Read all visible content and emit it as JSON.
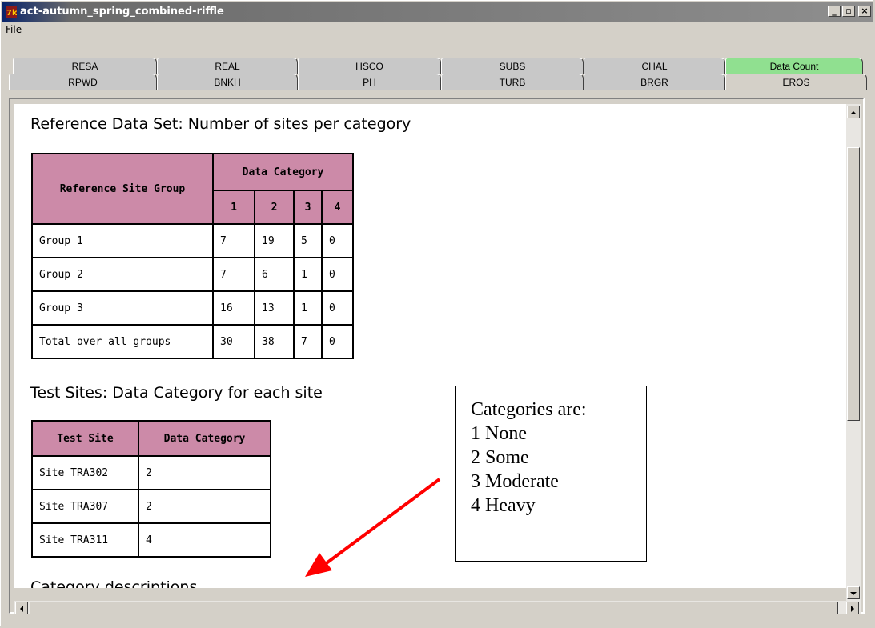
{
  "window": {
    "title": "act-autumn_spring_combined-riffle",
    "minimize": "_",
    "restore": "▫",
    "close": "×"
  },
  "menu": {
    "file": "File"
  },
  "tabs": {
    "row1": [
      "RESA",
      "REAL",
      "HSCO",
      "SUBS",
      "CHAL",
      "Data Count"
    ],
    "row2": [
      "RPWD",
      "BNKH",
      "PH",
      "TURB",
      "BRGR",
      "EROS"
    ],
    "active": "EROS",
    "green": "Data Count"
  },
  "reference": {
    "heading": "Reference Data Set: Number of sites per category",
    "col_group": "Reference Site Group",
    "col_category": "Data Category",
    "categories": [
      "1",
      "2",
      "3",
      "4"
    ],
    "rows": [
      {
        "group": "Group 1",
        "values": [
          "7",
          "19",
          "5",
          "0"
        ]
      },
      {
        "group": "Group 2",
        "values": [
          "7",
          "6",
          "1",
          "0"
        ]
      },
      {
        "group": "Group 3",
        "values": [
          "16",
          "13",
          "1",
          "0"
        ]
      },
      {
        "group": "Total over all groups",
        "values": [
          "30",
          "38",
          "7",
          "0"
        ]
      }
    ]
  },
  "test": {
    "heading": "Test Sites: Data Category for each site",
    "col_site": "Test Site",
    "col_category": "Data Category",
    "rows": [
      {
        "site": "Site TRA302",
        "category": "2"
      },
      {
        "site": "Site TRA307",
        "category": "2"
      },
      {
        "site": "Site TRA311",
        "category": "4"
      }
    ]
  },
  "descriptions": {
    "heading": "Category descriptions"
  },
  "callout": {
    "title": "Categories are:",
    "items": [
      "1  None",
      "2  Some",
      "3  Moderate",
      "4  Heavy"
    ]
  },
  "colors": {
    "header": "#cc8aa8",
    "tab_green": "#90e090",
    "arrow": "#ff0000"
  }
}
